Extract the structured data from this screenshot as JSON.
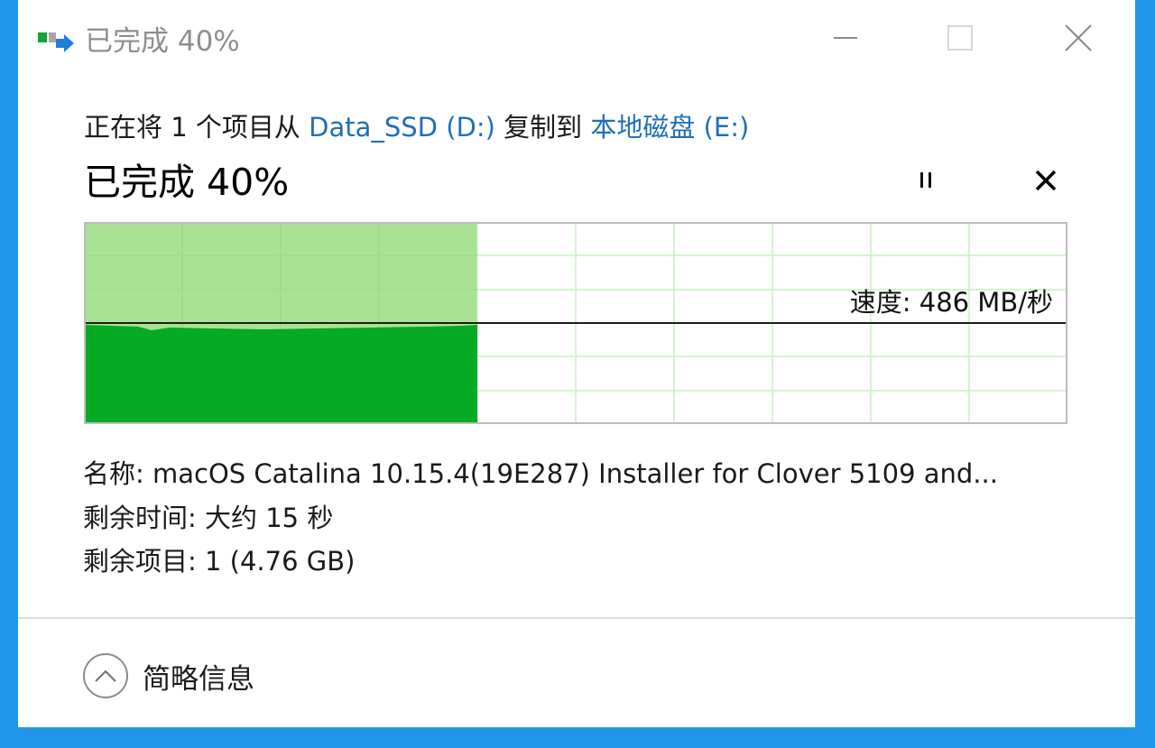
{
  "window": {
    "title": "已完成 40%",
    "controls": {
      "minimize": "minimize",
      "maximize": "maximize",
      "close": "close"
    }
  },
  "copy": {
    "prefix": "正在将 1 个项目从 ",
    "source": "Data_SSD (D:)",
    "middle": " 复制到 ",
    "destination": "本地磁盘 (E:)",
    "progress_title": "已完成 40%",
    "progress_percent": 40
  },
  "graph": {
    "speed_label": "速度: 486 MB/秒",
    "fill_color": "#04ab23",
    "progress_color": "#a8e394",
    "grid_color": "#c9efc4"
  },
  "details": {
    "name_label": "名称:  macOS Catalina 10.15.4(19E287) Installer for Clover 5109 and...",
    "time_label": "剩余时间: 大约 15 秒",
    "items_label": "剩余项目: 1 (4.76 GB)"
  },
  "footer": {
    "toggle_label": "简略信息"
  },
  "icons": {
    "app": "file-copy-icon",
    "pause": "pause-icon",
    "cancel": "close-icon",
    "toggle": "chevron-up-icon"
  }
}
